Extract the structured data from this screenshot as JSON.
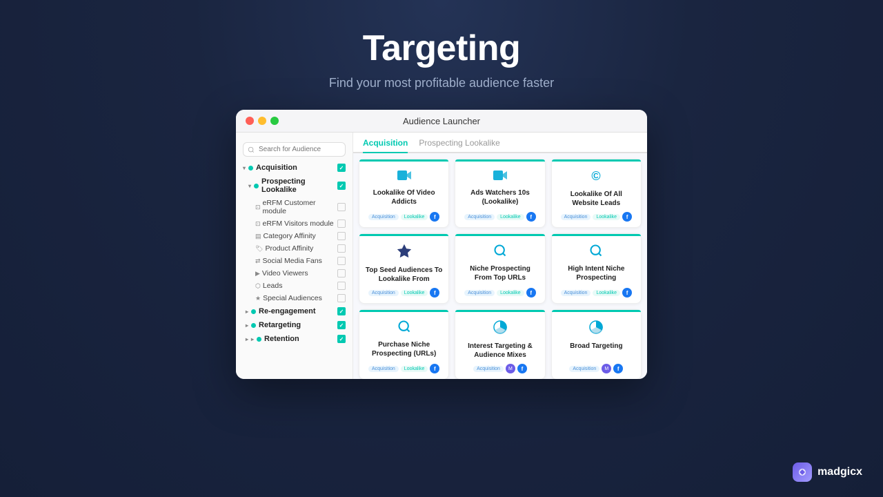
{
  "page": {
    "title": "Targeting",
    "subtitle": "Find your most profitable audience faster"
  },
  "window": {
    "title": "Audience Launcher"
  },
  "tabs": [
    {
      "label": "Acquisition",
      "active": true
    },
    {
      "label": "Prospecting Lookalike",
      "active": false
    }
  ],
  "sidebar": {
    "search_placeholder": "Search for Audience",
    "items": [
      {
        "label": "Acquisition",
        "level": 0,
        "type": "section",
        "checked": true
      },
      {
        "label": "Prospecting Lookalike",
        "level": 1,
        "type": "section",
        "checked": true
      },
      {
        "label": "eRFM Customer module",
        "level": 2,
        "type": "item",
        "checked": false
      },
      {
        "label": "eRFM Visitors module",
        "level": 2,
        "type": "item",
        "checked": false
      },
      {
        "label": "Category Affinity",
        "level": 2,
        "type": "item",
        "checked": false
      },
      {
        "label": "Product Affinity",
        "level": 2,
        "type": "item",
        "checked": false
      },
      {
        "label": "Social Media Fans",
        "level": 2,
        "type": "item",
        "checked": false
      },
      {
        "label": "Video Viewers",
        "level": 2,
        "type": "item",
        "checked": false
      },
      {
        "label": "Leads",
        "level": 2,
        "type": "item",
        "checked": false
      },
      {
        "label": "Special Audiences",
        "level": 2,
        "type": "item",
        "checked": false
      },
      {
        "label": "Re-engagement",
        "level": 1,
        "type": "section",
        "checked": true
      },
      {
        "label": "Retargeting",
        "level": 1,
        "type": "section",
        "checked": true
      },
      {
        "label": "Retention",
        "level": 1,
        "type": "section",
        "checked": true
      }
    ]
  },
  "cards": [
    {
      "id": "card1",
      "icon": "🎬",
      "title": "Lookalike Of Video Addicts",
      "tags": [
        "Acquisition",
        "Lookalike"
      ],
      "has_fb": true,
      "has_madgicx": false
    },
    {
      "id": "card2",
      "icon": "🎬",
      "title": "Ads Watchers 10s (Lookalike)",
      "tags": [
        "Acquisition",
        "Lookalike"
      ],
      "has_fb": true,
      "has_madgicx": false
    },
    {
      "id": "card3",
      "icon": "©",
      "title": "Lookalike Of All Website Leads",
      "tags": [
        "Acquisition",
        "Lookalike"
      ],
      "has_fb": true,
      "has_madgicx": false
    },
    {
      "id": "card4",
      "icon": "⭐",
      "title": "Top Seed Audiences To Lookalike From",
      "tags": [
        "Acquisition",
        "Lookalike"
      ],
      "has_fb": true,
      "has_madgicx": false
    },
    {
      "id": "card5",
      "icon": "🔍",
      "title": "Niche Prospecting From Top URLs",
      "tags": [
        "Acquisition",
        "Lookalike"
      ],
      "has_fb": true,
      "has_madgicx": false
    },
    {
      "id": "card6",
      "icon": "🔍",
      "title": "High Intent Niche Prospecting",
      "tags": [
        "Acquisition",
        "Lookalike"
      ],
      "has_fb": true,
      "has_madgicx": false
    },
    {
      "id": "card7",
      "icon": "🔍",
      "title": "Purchase Niche Prospecting (URLs)",
      "tags": [
        "Acquisition",
        "Lookalike"
      ],
      "has_fb": true,
      "has_madgicx": false
    },
    {
      "id": "card8",
      "icon": "🥧",
      "title": "Interest Targeting & Audience Mixes",
      "tags": [
        "Acquisition"
      ],
      "has_fb": true,
      "has_madgicx": true
    },
    {
      "id": "card9",
      "icon": "🥧",
      "title": "Broad Targeting",
      "tags": [
        "Acquisition"
      ],
      "has_fb": true,
      "has_madgicx": true
    }
  ],
  "logo": {
    "icon": "m",
    "text": "madgicx"
  }
}
